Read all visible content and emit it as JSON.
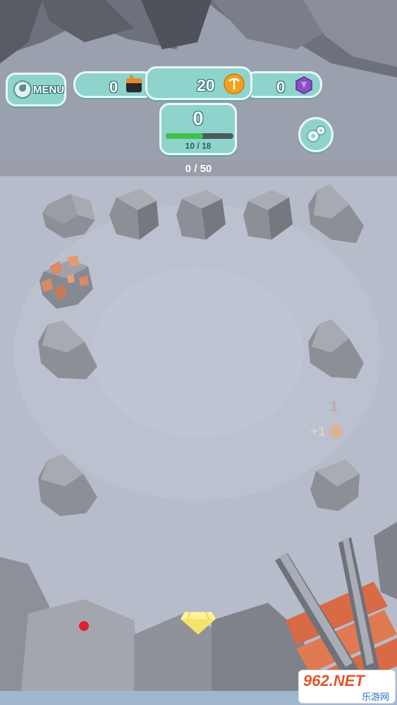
{
  "hud": {
    "menu_label": "MENU",
    "crates_count": "0",
    "coins_count": "20",
    "gems_count": "0",
    "level_value": "0",
    "level_progress_text": "10 / 18",
    "level_progress_fraction": 0.556
  },
  "rocks_counter": "0 / 50",
  "floating": {
    "damage_text": "1",
    "reward_text": "+1"
  },
  "watermark": {
    "brand": "962.NET",
    "subtitle": "乐游网"
  },
  "colors": {
    "hud_teal": "#8fd3cd",
    "coin_orange": "#f3a01c",
    "gem_purple": "#8a4fc4",
    "progress_green": "#43c04a",
    "copper": "#d98b63"
  },
  "icons": [
    "menu-dragon-icon",
    "crate-icon",
    "coin-pickaxe-icon",
    "gem-icon",
    "gear-icon",
    "diamond-icon"
  ]
}
